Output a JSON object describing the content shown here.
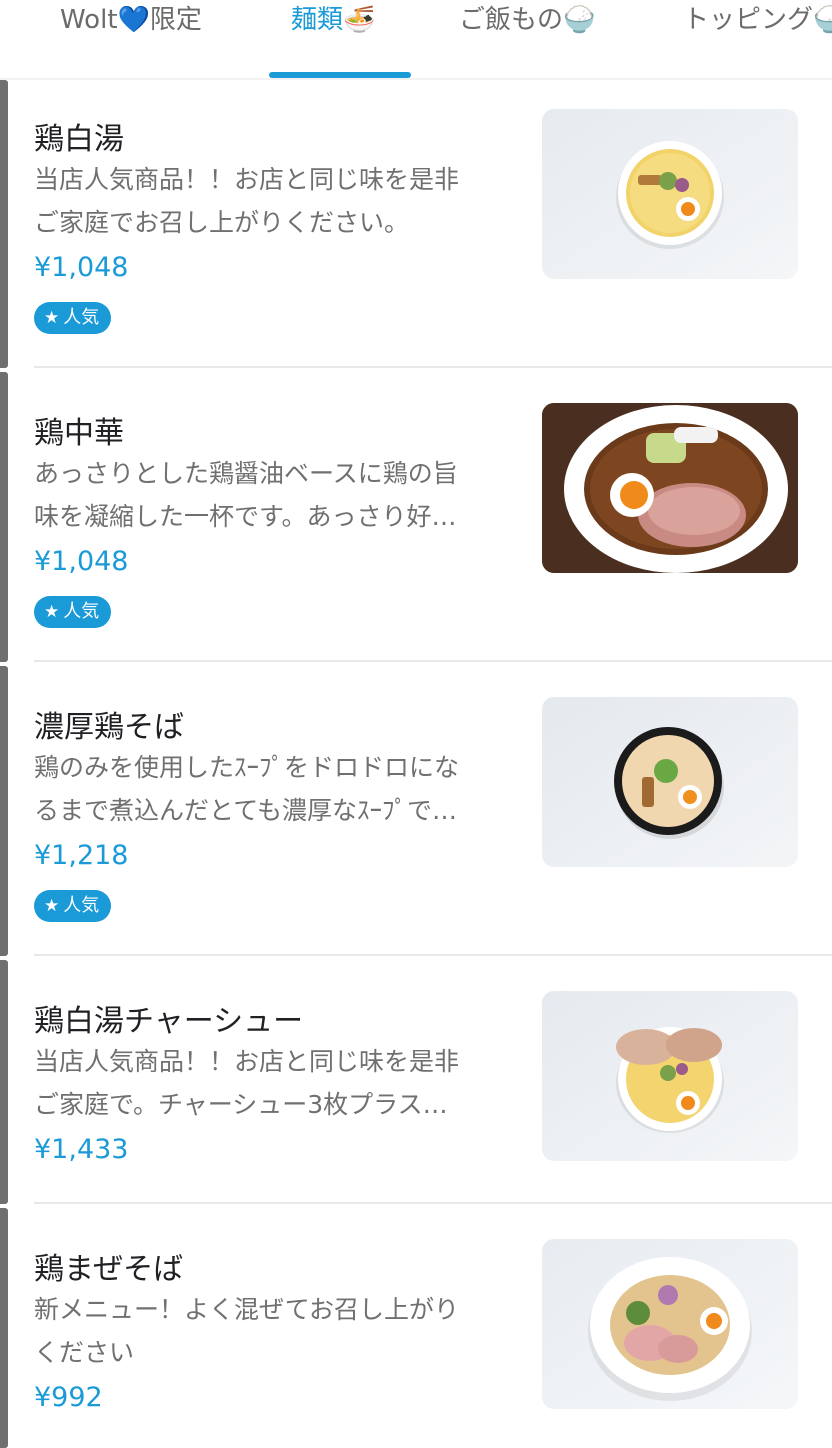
{
  "tabs": [
    {
      "label": "Wolt💙限定",
      "active": false
    },
    {
      "label": "麺類🍜",
      "active": true
    },
    {
      "label": "ご飯もの🍚",
      "active": false
    },
    {
      "label": "トッピング🍚",
      "active": false
    }
  ],
  "items": [
    {
      "title": "鶏白湯",
      "desc_line1": "当店人気商品！！お店と同じ味を是非",
      "desc_line2": "ご家庭でお召し上がりください。",
      "price": "¥1,048",
      "badge": "人気",
      "image": "bowl-paitan"
    },
    {
      "title": "鶏中華",
      "desc_line1": "あっさりとした鶏醤油ベースに鶏の旨",
      "desc_line2": "味を凝縮した一杯です。あっさり好…",
      "price": "¥1,048",
      "badge": "人気",
      "image": "bowl-shoyu"
    },
    {
      "title": "濃厚鶏そば",
      "desc_line1": "鶏のみを使用したｽｰﾌﾟをドロドロにな",
      "desc_line2": "るまで煮込んだとても濃厚なｽｰﾌﾟで…",
      "price": "¥1,218",
      "badge": "人気",
      "image": "bowl-noko"
    },
    {
      "title": "鶏白湯チャーシュー",
      "desc_line1": "当店人気商品！！お店と同じ味を是非",
      "desc_line2": "ご家庭で。チャーシュー3枚プラス…",
      "price": "¥1,433",
      "badge": null,
      "image": "bowl-chashu"
    },
    {
      "title": "鶏まぜそば",
      "desc_line1": "新メニュー！よく混ぜてお召し上がり",
      "desc_line2": "ください",
      "price": "¥992",
      "badge": null,
      "image": "bowl-mazesoba"
    }
  ],
  "colors": {
    "accent": "#1a9ad6",
    "price": "#1a9ad6",
    "text": "#202125",
    "muted": "#707070"
  }
}
